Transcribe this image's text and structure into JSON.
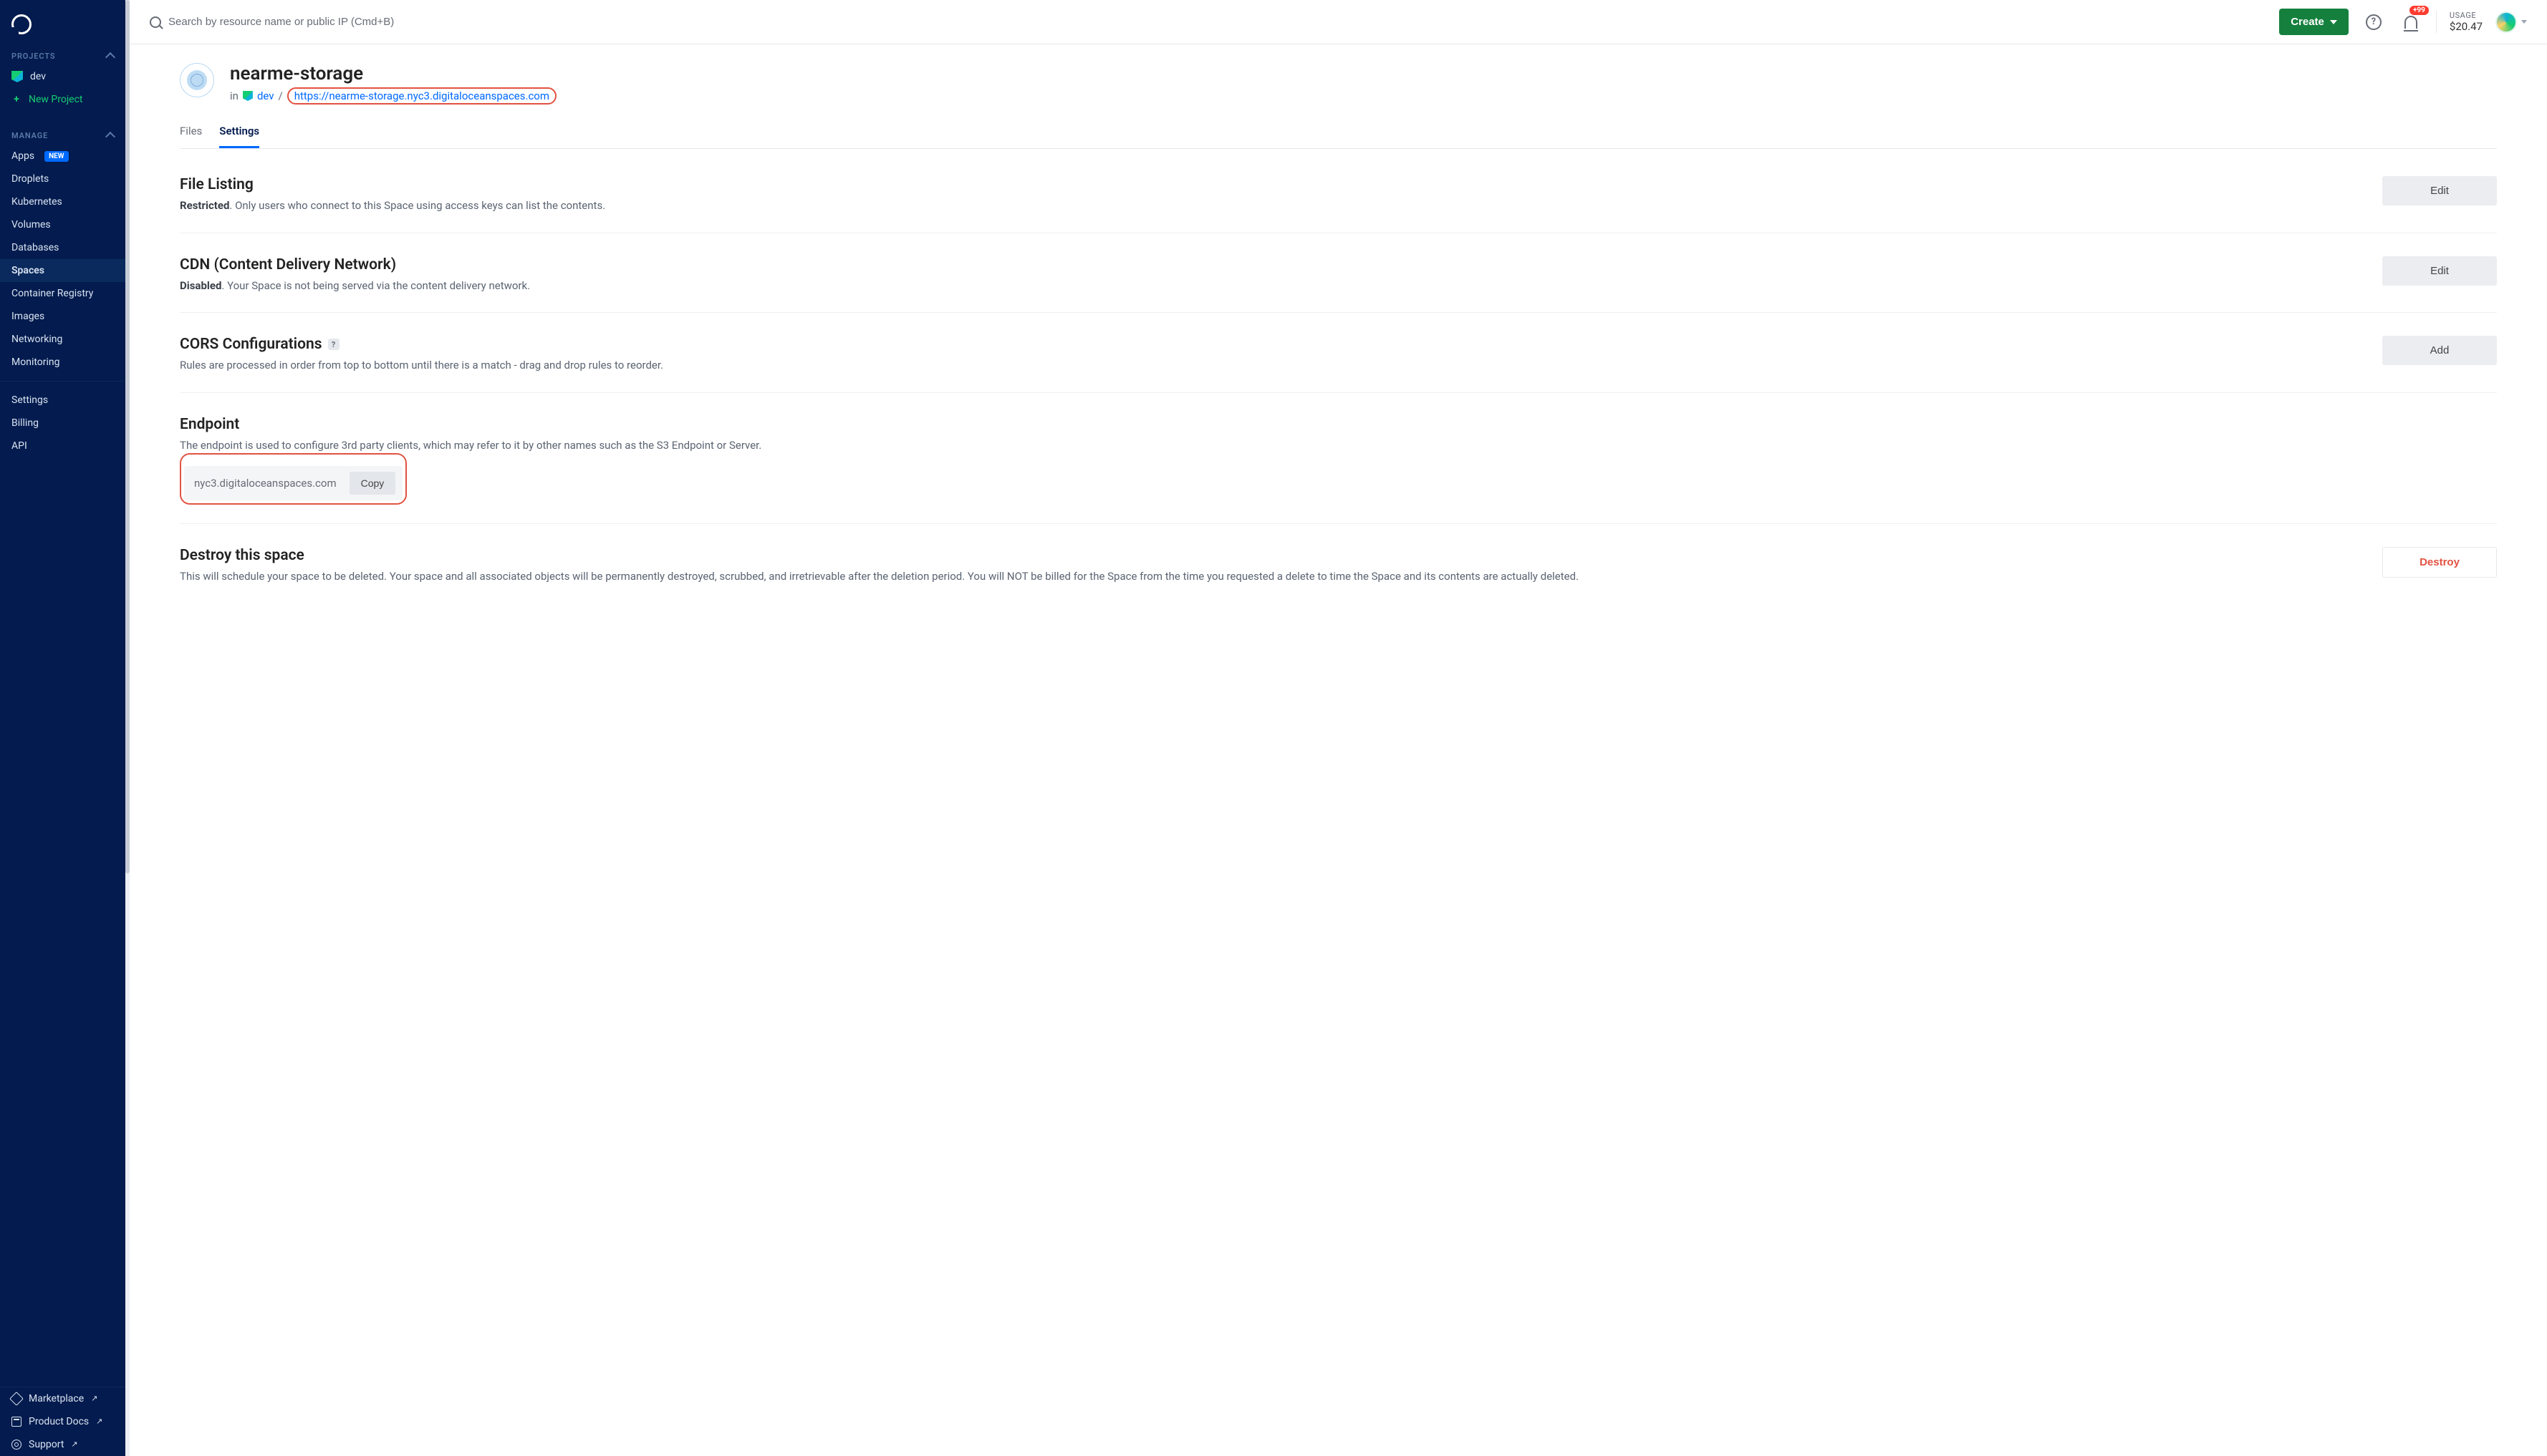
{
  "sidebar": {
    "projects_header": "PROJECTS",
    "project_name": "dev",
    "new_project": "New Project",
    "manage_header": "MANAGE",
    "items": [
      {
        "label": "Apps",
        "badge": "NEW"
      },
      {
        "label": "Droplets"
      },
      {
        "label": "Kubernetes"
      },
      {
        "label": "Volumes"
      },
      {
        "label": "Databases"
      },
      {
        "label": "Spaces",
        "active": true
      },
      {
        "label": "Container Registry"
      },
      {
        "label": "Images"
      },
      {
        "label": "Networking"
      },
      {
        "label": "Monitoring"
      }
    ],
    "account_items": [
      {
        "label": "Settings"
      },
      {
        "label": "Billing"
      },
      {
        "label": "API"
      }
    ],
    "footer_items": [
      {
        "label": "Marketplace"
      },
      {
        "label": "Product Docs"
      },
      {
        "label": "Support"
      }
    ]
  },
  "topbar": {
    "search_placeholder": "Search by resource name or public IP (Cmd+B)",
    "create_label": "Create",
    "notif_count": "+99",
    "usage_label": "USAGE",
    "usage_amount": "$20.47"
  },
  "page": {
    "title": "nearme-storage",
    "in_label": "in",
    "project": "dev",
    "slash": "/",
    "url": "https://nearme-storage.nyc3.digitaloceanspaces.com",
    "tabs": {
      "files": "Files",
      "settings": "Settings"
    }
  },
  "sections": {
    "file_listing": {
      "title": "File Listing",
      "status": "Restricted",
      "desc": ". Only users who connect to this Space using access keys can list the contents.",
      "action": "Edit"
    },
    "cdn": {
      "title": "CDN (Content Delivery Network)",
      "status": "Disabled",
      "desc": ". Your Space is not being served via the content delivery network.",
      "action": "Edit"
    },
    "cors": {
      "title": "CORS Configurations",
      "desc": "Rules are processed in order from top to bottom until there is a match - drag and drop rules to reorder.",
      "action": "Add"
    },
    "endpoint": {
      "title": "Endpoint",
      "desc": "The endpoint is used to configure 3rd party clients, which may refer to it by other names such as the S3 Endpoint or Server.",
      "value": "nyc3.digitaloceanspaces.com",
      "copy": "Copy"
    },
    "destroy": {
      "title": "Destroy this space",
      "desc": "This will schedule your space to be deleted. Your space and all associated objects will be permanently destroyed, scrubbed, and irretrievable after the deletion period. You will NOT be billed for the Space from the time you requested a delete to time the Space and its contents are actually deleted.",
      "action": "Destroy"
    }
  }
}
